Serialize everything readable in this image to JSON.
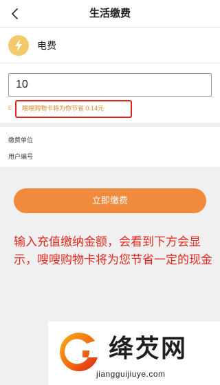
{
  "nav": {
    "title": "生活缴费",
    "back_icon": "chevron-left-icon"
  },
  "bill": {
    "label": "电费",
    "icon": "lightning-icon",
    "icon_color": "#f3ca6b"
  },
  "amount": {
    "value": "10",
    "tip_mark": "E",
    "tip_text": "嗖嗖购物卡将为你节省 0.14元"
  },
  "info": {
    "unit_label": "缴费单位",
    "user_label": "用户编号"
  },
  "pay_button": {
    "label": "立即缴费",
    "color": "#f08a3c"
  },
  "annotation": {
    "text": "输入充值缴纳金额，会看到下方会显示，嗖嗖购物卡将为您节省一定的现金",
    "color": "#e2281e"
  },
  "watermark": {
    "name": "绛芡网",
    "url": "jiangguijiuye.com"
  }
}
